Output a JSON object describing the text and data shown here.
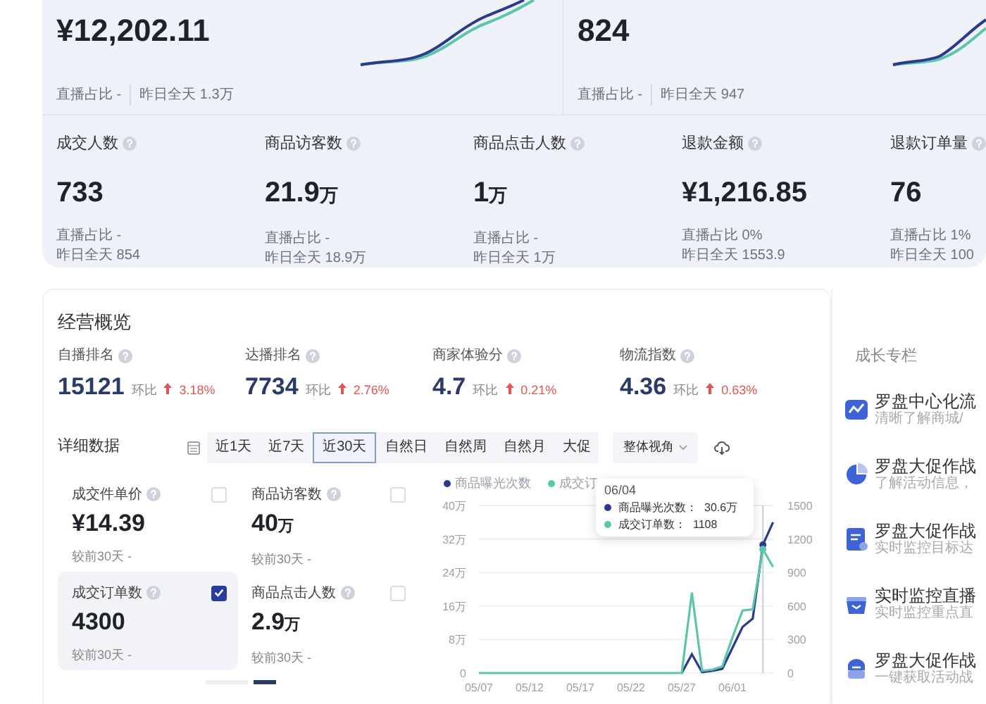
{
  "top": {
    "cards": [
      {
        "value": "¥12,202.11",
        "sub": [
          "直播占比 -",
          "昨日全天 1.3万"
        ]
      },
      {
        "value": "824",
        "sub": [
          "直播占比 -",
          "昨日全天 947"
        ]
      }
    ],
    "metrics": [
      {
        "label": "成交人数",
        "value": "733",
        "sub": [
          "直播占比 -",
          "昨日全天 854"
        ]
      },
      {
        "label": "商品访客数",
        "value": "21.9",
        "unit": "万",
        "sub": [
          "直播占比 -",
          "昨日全天 18.9万"
        ]
      },
      {
        "label": "商品点击人数",
        "value": "1",
        "unit": "万",
        "sub": [
          "直播占比 -",
          "昨日全天 1万"
        ]
      },
      {
        "label": "退款金额",
        "value": "¥1,216.85",
        "sub": [
          "直播占比 0%",
          "昨日全天 1553.9"
        ]
      },
      {
        "label": "退款订单量",
        "value": "76",
        "sub": [
          "直播占比 1%",
          "昨日全天 100"
        ]
      }
    ]
  },
  "business": {
    "title": "经营概览",
    "metrics": [
      {
        "label": "自播排名",
        "value": "15121",
        "compare_label": "环比",
        "change": "3.18%"
      },
      {
        "label": "达播排名",
        "value": "7734",
        "compare_label": "环比",
        "change": "2.76%"
      },
      {
        "label": "商家体验分",
        "value": "4.7",
        "compare_label": "环比",
        "change": "0.21%"
      },
      {
        "label": "物流指数",
        "value": "4.36",
        "compare_label": "环比",
        "change": "0.63%"
      }
    ]
  },
  "detail": {
    "title": "详细数据",
    "tabs": [
      {
        "label": "近1天",
        "selected": false
      },
      {
        "label": "近7天",
        "selected": false
      },
      {
        "label": "近30天",
        "selected": true
      },
      {
        "label": "自然日",
        "selected": false
      },
      {
        "label": "自然周",
        "selected": false
      },
      {
        "label": "自然月",
        "selected": false
      },
      {
        "label": "大促",
        "selected": false
      }
    ],
    "view_select": {
      "value": "整体视角"
    },
    "cards": [
      {
        "label": "成交件单价",
        "value": "¥14.39",
        "note": "较前30天 -",
        "checked": false
      },
      {
        "label": "商品访客数",
        "value": "40",
        "unit": "万",
        "note": "较前30天 -",
        "checked": false
      },
      {
        "label": "成交订单数",
        "value": "4300",
        "note": "较前30天 -",
        "checked": true
      },
      {
        "label": "商品点击人数",
        "value": "2.9",
        "unit": "万",
        "note": "较前30天 -",
        "checked": false
      }
    ],
    "pages": [
      {
        "selected": false
      },
      {
        "selected": true
      }
    ],
    "legend": [
      {
        "label": "商品曝光次数",
        "color": "#2b3a8c"
      },
      {
        "label": "成交订",
        "color": "#5cc6a8"
      }
    ],
    "tooltip": {
      "date": "06/04",
      "rows": [
        {
          "label": "商品曝光次数：",
          "value": "30.6万",
          "color": "#2b3a8c"
        },
        {
          "label": "成交订单数：",
          "value": "1108",
          "color": "#5cc6a8"
        }
      ]
    },
    "chart_data": {
      "type": "line",
      "categories": [
        "05/07",
        null,
        null,
        null,
        null,
        "05/12",
        null,
        null,
        null,
        null,
        "05/17",
        null,
        null,
        null,
        null,
        "05/22",
        null,
        null,
        null,
        null,
        "05/27",
        null,
        null,
        null,
        null,
        "06/01",
        null,
        null,
        null,
        null
      ],
      "series": [
        {
          "color": "#2b3a8c",
          "axis": "y",
          "values": [
            null,
            null,
            null,
            null,
            null,
            null,
            null,
            null,
            null,
            null,
            null,
            null,
            null,
            null,
            null,
            null,
            null,
            null,
            null,
            null,
            0,
            4.5,
            0.2,
            0.5,
            1,
            6,
            11,
            13,
            30.6,
            36
          ]
        },
        {
          "color": "#5cc6a8",
          "axis": "y2",
          "values": [
            0,
            0,
            0,
            0,
            0,
            0,
            0,
            0,
            0,
            0,
            0,
            0,
            0,
            0,
            0,
            0,
            0,
            0,
            0,
            0,
            0,
            720,
            20,
            30,
            60,
            320,
            560,
            570,
            1108,
            950
          ]
        }
      ],
      "grid": true,
      "ylim": [
        0,
        40
      ],
      "yticks": [
        {
          "value": 0,
          "label": "0"
        },
        {
          "value": 8,
          "label": "8万"
        },
        {
          "value": 16,
          "label": "16万"
        },
        {
          "value": 24,
          "label": "24万"
        },
        {
          "value": 32,
          "label": "32万"
        },
        {
          "value": 40,
          "label": "40万"
        }
      ],
      "y2lim": [
        0,
        1500
      ],
      "y2ticks": [
        0,
        300,
        600,
        900,
        1200,
        1500
      ]
    }
  },
  "sidebar": {
    "title": "成长专栏",
    "items": [
      {
        "title": "罗盘中心化流",
        "desc": "清晰了解商城/"
      },
      {
        "title": "罗盘大促作战",
        "desc": "了解活动信息，"
      },
      {
        "title": "罗盘大促作战",
        "desc": "实时监控目标达"
      },
      {
        "title": "实时监控直播",
        "desc": "实时监控重点直"
      },
      {
        "title": "罗盘大促作战",
        "desc": "一键获取活动战"
      }
    ]
  }
}
